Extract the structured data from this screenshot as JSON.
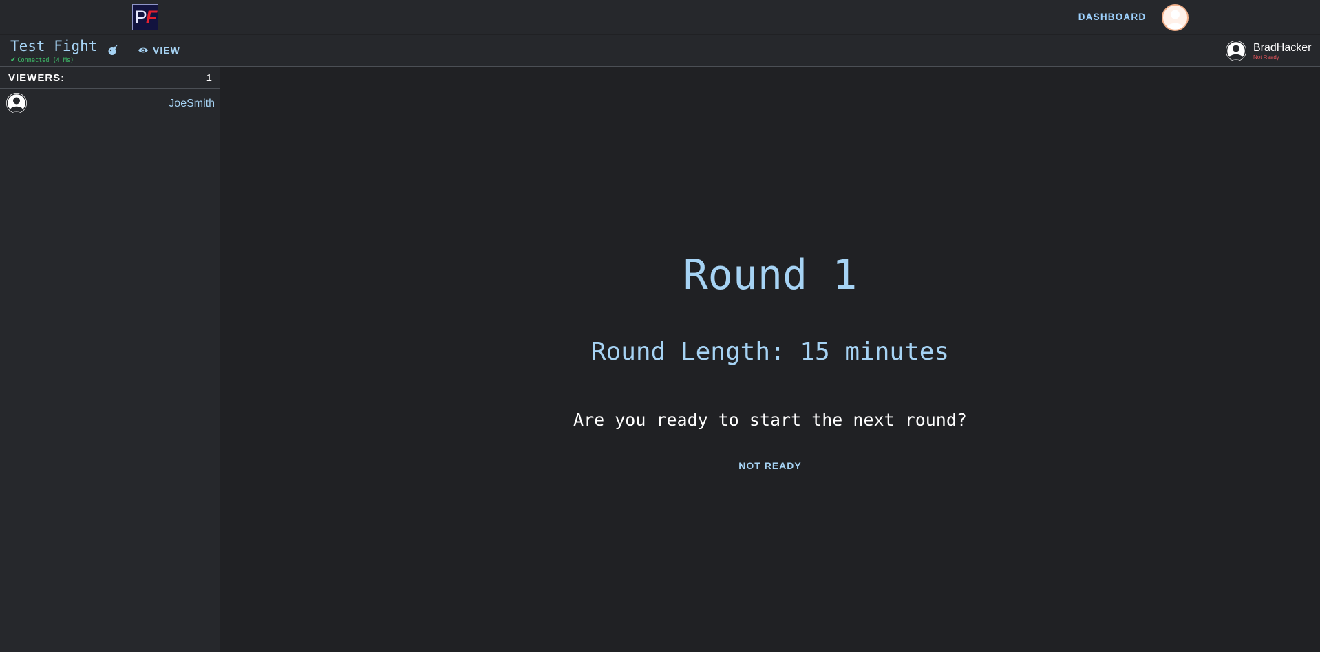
{
  "header": {
    "logo_text": "PF",
    "nav": {
      "dashboard_label": "DASHBOARD"
    }
  },
  "fight": {
    "title": "Test Fight",
    "connection_status": "Connected (4 Ms)",
    "view_label": "VIEW"
  },
  "player": {
    "name": "BradHacker",
    "status": "Not Ready"
  },
  "sidebar": {
    "viewers_label": "VIEWERS:",
    "viewers_count": "1",
    "viewers": [
      {
        "name": "JoeSmith"
      }
    ]
  },
  "round": {
    "title": "Round 1",
    "length_text": "Round Length: 15 minutes",
    "question": "Are you ready to start the next round?",
    "ready_button_label": "NOT READY"
  },
  "colors": {
    "background": "#202124",
    "panel": "#26282c",
    "accent": "#a6d3f4",
    "connected": "#3fbf6a",
    "not_ready": "#e2555b"
  },
  "icons": {
    "logo": "app-logo",
    "bomb": "bomb-icon",
    "view": "eye-icon",
    "check": "check-icon",
    "avatar": "user-avatar-icon"
  }
}
